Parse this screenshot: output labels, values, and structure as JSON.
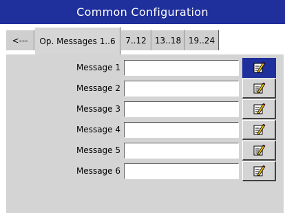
{
  "window": {
    "title": "Common Configuration"
  },
  "tabs": [
    {
      "label": "<---"
    },
    {
      "label": "Op. Messages 1..6"
    },
    {
      "label": "7..12"
    },
    {
      "label": "13..18"
    },
    {
      "label": "19..24"
    }
  ],
  "messages": [
    {
      "label": "Message 1",
      "value": ""
    },
    {
      "label": "Message 2",
      "value": ""
    },
    {
      "label": "Message 3",
      "value": ""
    },
    {
      "label": "Message 4",
      "value": ""
    },
    {
      "label": "Message 5",
      "value": ""
    },
    {
      "label": "Message 6",
      "value": ""
    }
  ],
  "edit_icon": "edit-pencil-icon",
  "colors": {
    "title_bar": "#1f2f9c",
    "panel": "#d4d4d4",
    "selected_button": "#1f2f9c"
  }
}
